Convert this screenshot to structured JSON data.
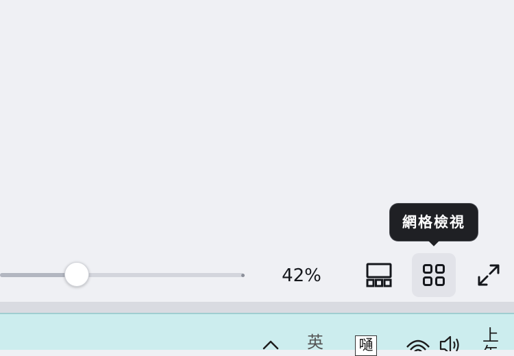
{
  "zoom": {
    "percent_label": "42%",
    "level_fraction": 0.316
  },
  "view_buttons": {
    "tooltip": "網格檢視"
  },
  "taskbar": {
    "ime_mode_glyph": "英",
    "ime_pad_glyph": "嗵",
    "clock_time": "上午"
  },
  "colors": {
    "canvas_bg": "#eff0f4",
    "tooltip_bg": "#1f2024",
    "taskbar_bg": "#ccedee",
    "selected_button_bg": "#e2e3e9"
  }
}
